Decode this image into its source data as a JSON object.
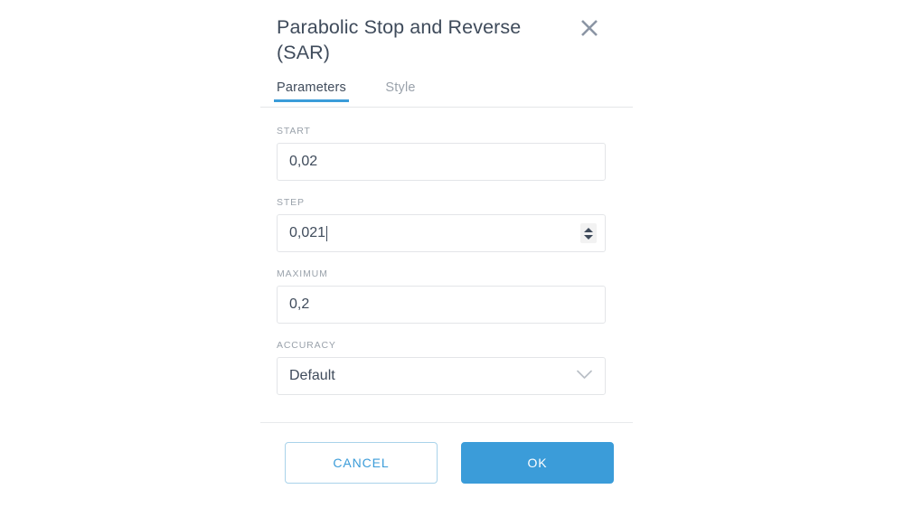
{
  "dialog": {
    "title": "Parabolic Stop and Reverse (SAR)",
    "close_icon": "close-icon",
    "accent_color": "#3b9cd9",
    "tabs": [
      {
        "label": "Parameters",
        "active": true
      },
      {
        "label": "Style",
        "active": false
      }
    ],
    "fields": [
      {
        "label": "START",
        "value": "0,02",
        "type": "text",
        "control": "none"
      },
      {
        "label": "STEP",
        "value": "0,021",
        "type": "number",
        "control": "spinner",
        "focused": true
      },
      {
        "label": "MAXIMUM",
        "value": "0,2",
        "type": "text",
        "control": "none"
      },
      {
        "label": "ACCURACY",
        "value": "Default",
        "type": "select",
        "control": "chevron-down"
      }
    ],
    "buttons": {
      "cancel_label": "CANCEL",
      "ok_label": "OK"
    }
  }
}
